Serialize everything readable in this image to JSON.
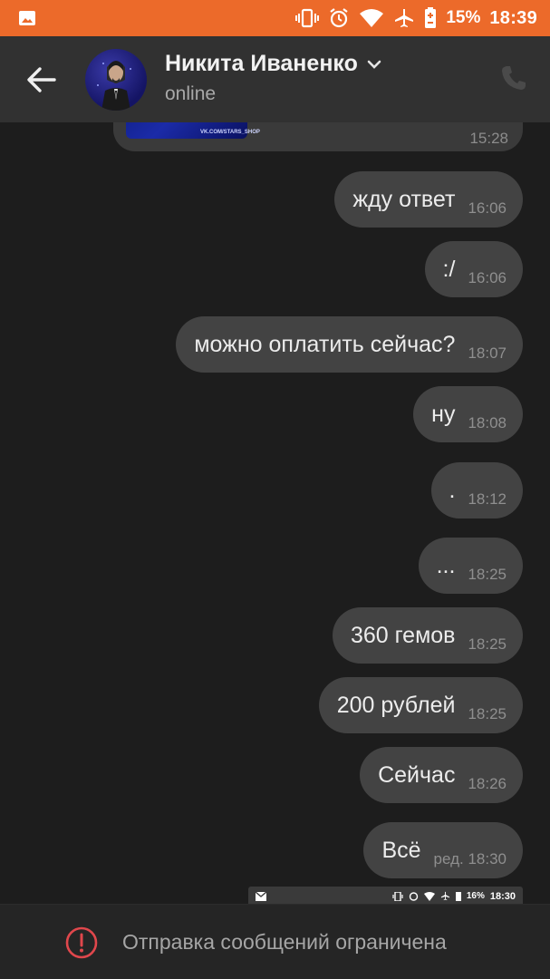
{
  "status_bar": {
    "battery": "15%",
    "time": "18:39"
  },
  "header": {
    "contact_name": "Никита Иваненко",
    "status": "online"
  },
  "previous_message": {
    "time": "15:28",
    "image_caption": "VK.COM/STARS_SHOP"
  },
  "messages": [
    {
      "text": "жду ответ",
      "time": "16:06"
    },
    {
      "text": ":/",
      "time": "16:06"
    },
    {
      "text": "можно оплатить сейчас?",
      "time": "18:07"
    },
    {
      "text": "ну",
      "time": "18:08"
    },
    {
      "text": ".",
      "time": "18:12"
    },
    {
      "text": "...",
      "time": "18:25"
    },
    {
      "text": "360 гемов",
      "time": "18:25"
    },
    {
      "text": "200 рублей",
      "time": "18:25"
    },
    {
      "text": "Сейчас",
      "time": "18:26"
    },
    {
      "text": "Всё",
      "time": "ред. 18:30"
    }
  ],
  "mini_status_bar": {
    "battery": "16%",
    "time": "18:30"
  },
  "bottom_bar": {
    "notice": "Отправка сообщений ограничена"
  },
  "colors": {
    "status_bar": "#ec6a2a",
    "header": "#313131",
    "bubble": "#434343",
    "warning": "#e0474c"
  }
}
